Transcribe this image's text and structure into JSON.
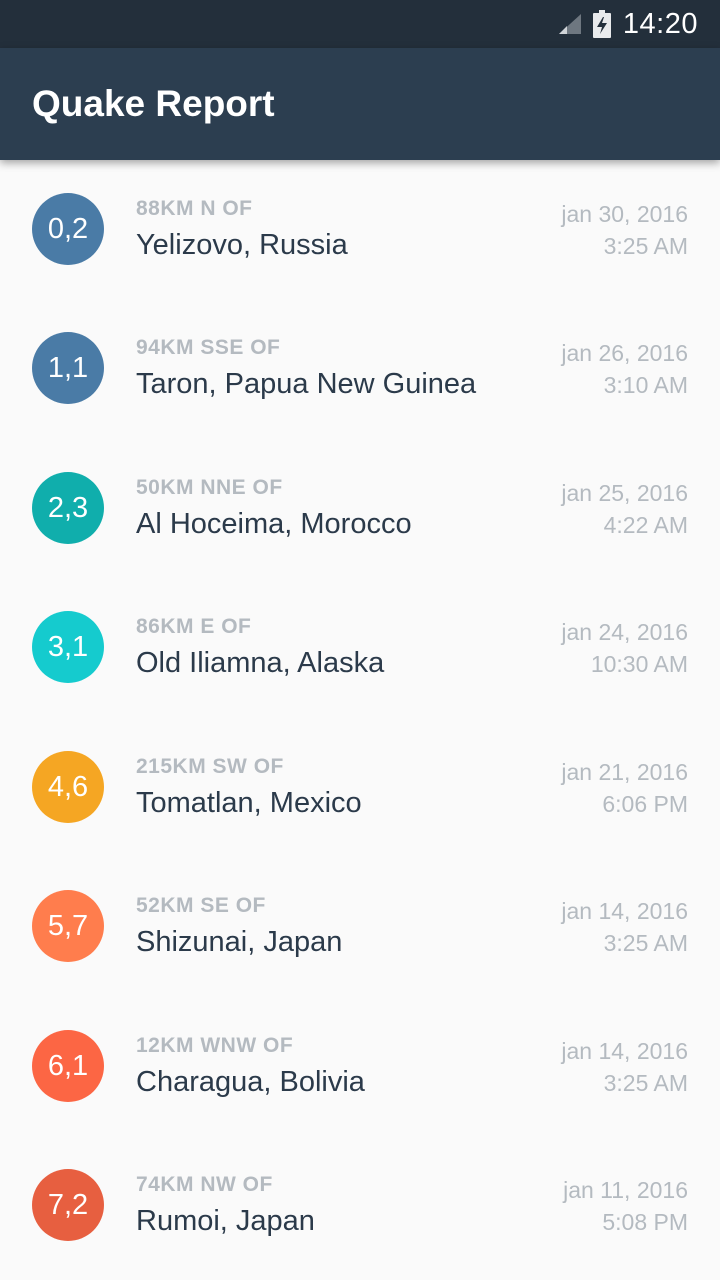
{
  "status_bar": {
    "time": "14:20",
    "icons": [
      "signal-icon",
      "battery-charging-icon"
    ]
  },
  "app_bar": {
    "title": "Quake Report",
    "color": "#2c3e50"
  },
  "earthquakes": [
    {
      "magnitude": "0,2",
      "offset": "88KM N OF",
      "place": "Yelizovo, Russia",
      "date": "jan 30, 2016",
      "time": "3:25 AM",
      "color": "#4a7ba6"
    },
    {
      "magnitude": "1,1",
      "offset": "94KM SSE OF",
      "place": "Taron, Papua New Guinea",
      "date": "jan 26, 2016",
      "time": "3:10 AM",
      "color": "#4a7ba6"
    },
    {
      "magnitude": "2,3",
      "offset": "50KM NNE OF",
      "place": "Al Hoceima, Morocco",
      "date": "jan 25, 2016",
      "time": "4:22 AM",
      "color": "#10aeac"
    },
    {
      "magnitude": "3,1",
      "offset": "86KM E OF",
      "place": "Old Iliamna, Alaska",
      "date": "jan 24, 2016",
      "time": "10:30 AM",
      "color": "#15cbce"
    },
    {
      "magnitude": "4,6",
      "offset": "215KM SW OF",
      "place": "Tomatlan, Mexico",
      "date": "jan 21, 2016",
      "time": "6:06 PM",
      "color": "#f5a623"
    },
    {
      "magnitude": "5,7",
      "offset": "52KM SE OF",
      "place": "Shizunai, Japan",
      "date": "jan 14, 2016",
      "time": "3:25 AM",
      "color": "#ff7d4d"
    },
    {
      "magnitude": "6,1",
      "offset": "12KM WNW OF",
      "place": "Charagua, Bolivia",
      "date": "jan 14, 2016",
      "time": "3:25 AM",
      "color": "#fc6644"
    },
    {
      "magnitude": "7,2",
      "offset": "74KM NW OF",
      "place": "Rumoi, Japan",
      "date": "jan 11, 2016",
      "time": "5:08 PM",
      "color": "#e75f40"
    }
  ]
}
